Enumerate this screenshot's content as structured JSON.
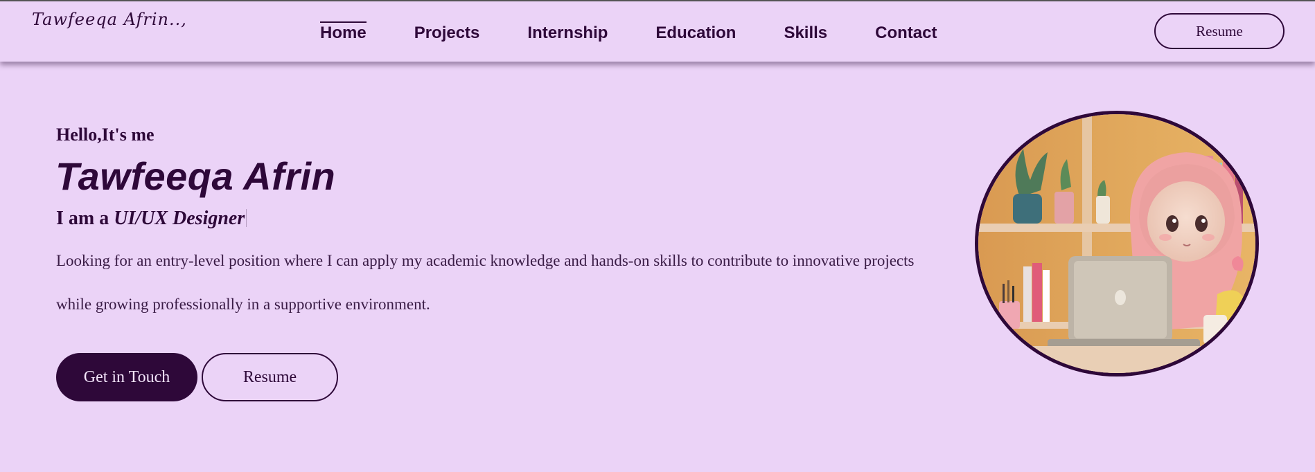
{
  "header": {
    "logo": "Tawfeeqa Afrin..,",
    "nav": [
      "Home",
      "Projects",
      "Internship",
      "Education",
      "Skills",
      "Contact"
    ],
    "active": "Home",
    "resume_label": "Resume"
  },
  "hero": {
    "greeting": "Hello,It's me",
    "name": "Tawfeeqa Afrin",
    "role_prefix": "I am a",
    "role": "UI/UX Designer",
    "description": "Looking for an entry-level position where I can apply my academic knowledge and hands-on skills to contribute to innovative projects while growing professionally in a supportive environment.",
    "cta_primary": "Get in Touch",
    "cta_secondary": "Resume"
  },
  "colors": {
    "background": "#ebd3f7",
    "primary": "#2e0839",
    "button_text": "#f3e4fa"
  },
  "avatar": {
    "icon": "girl-hijab-laptop-illustration"
  }
}
